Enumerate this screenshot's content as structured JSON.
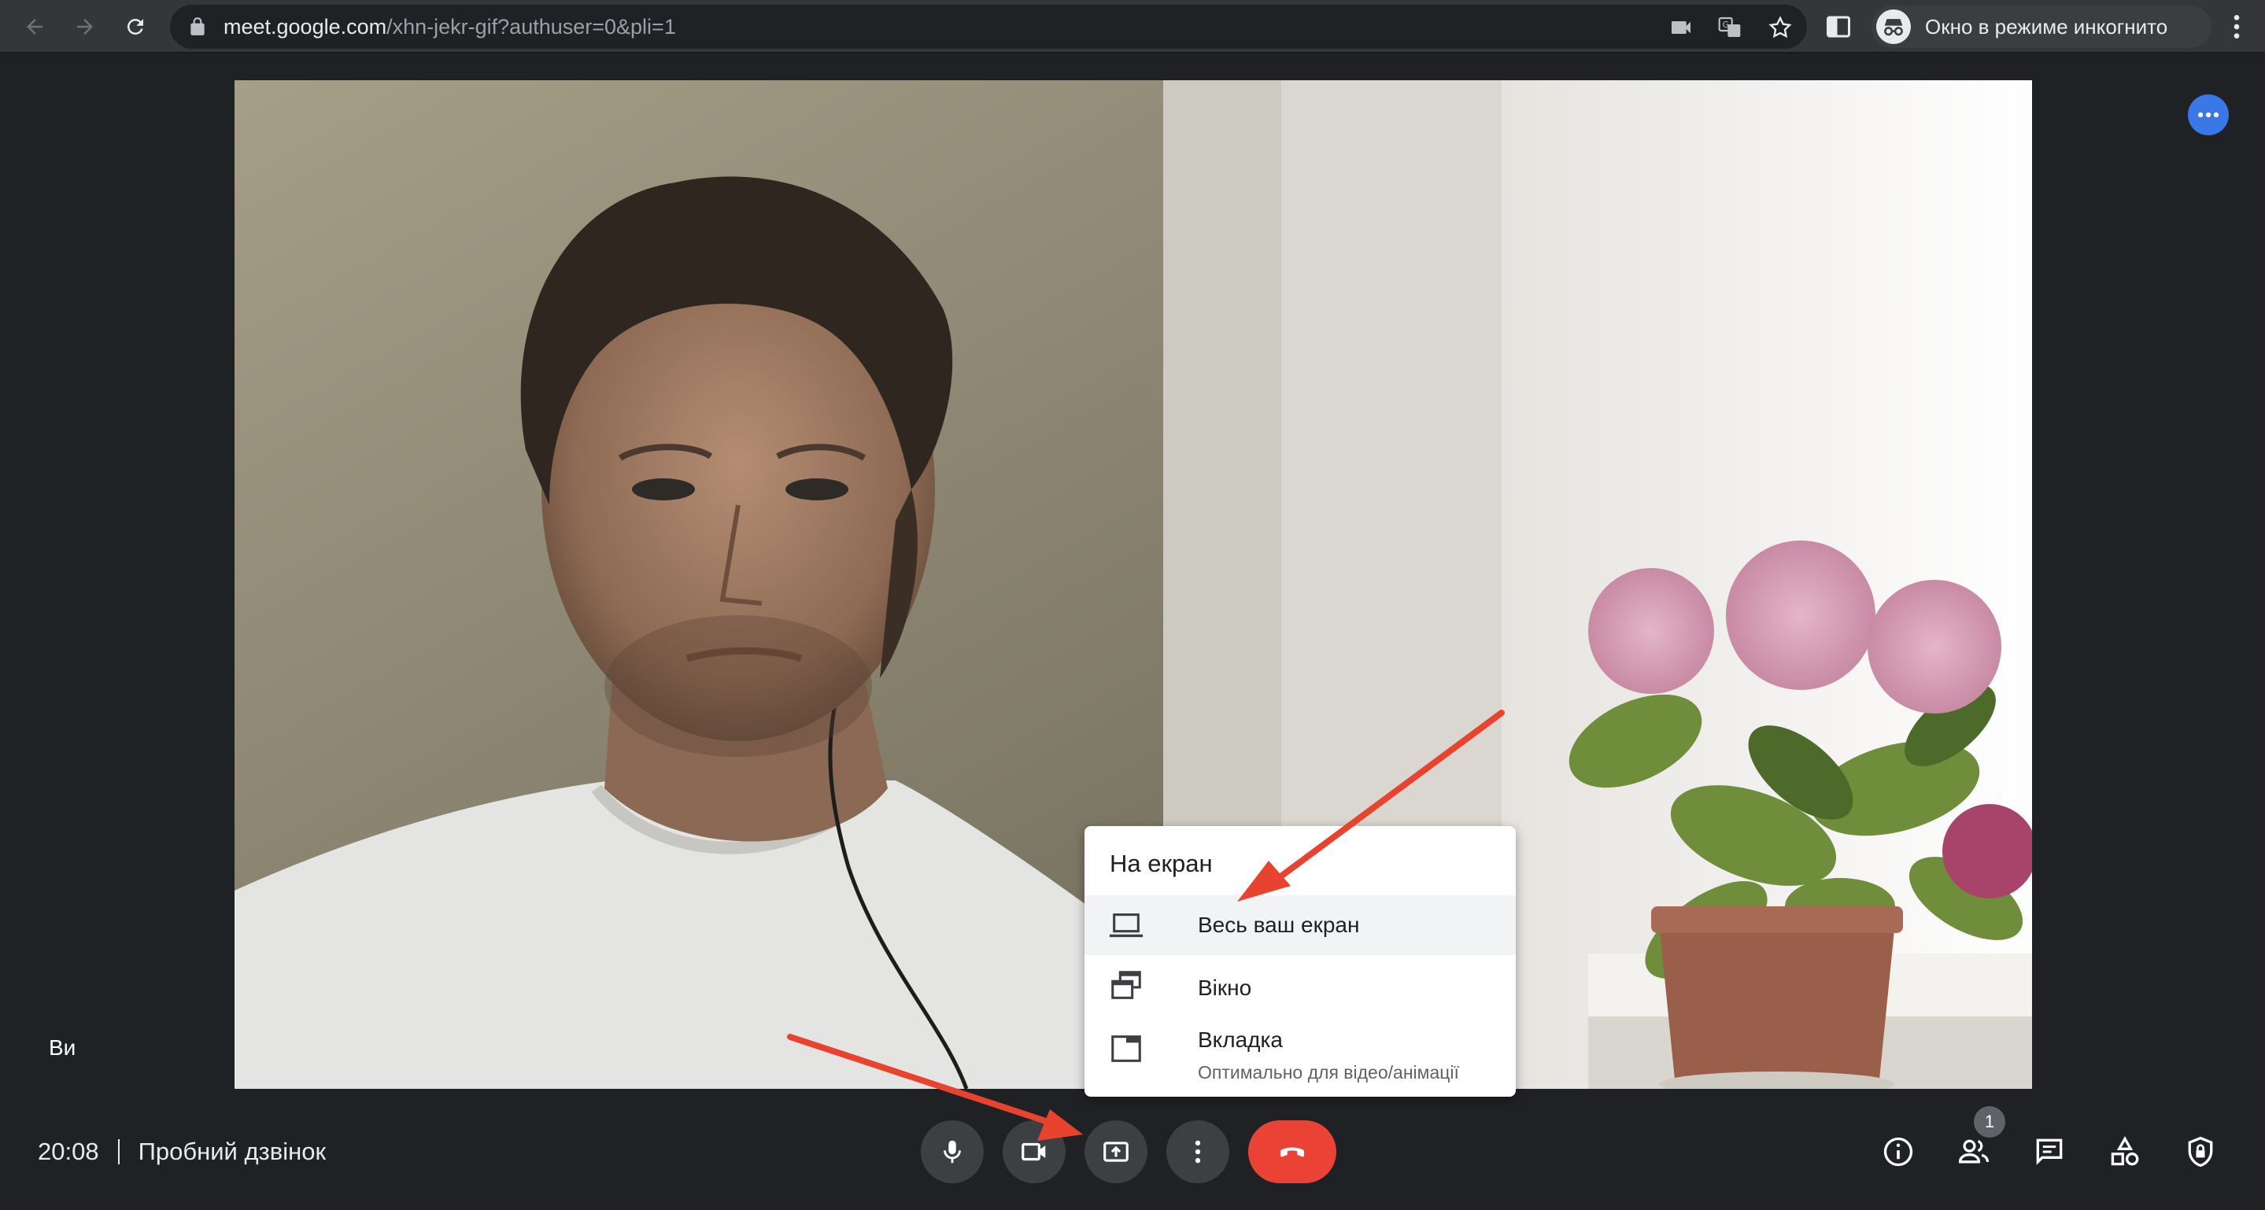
{
  "browser": {
    "url_host": "meet.google.com",
    "url_path": "/xhn-jekr-gif?authuser=0&pli=1",
    "incognito_label": "Окно в режиме инкогнито",
    "icons": [
      "back-arrow-icon",
      "forward-arrow-icon",
      "reload-icon",
      "lock-icon",
      "camera-icon",
      "translate-icon",
      "star-icon",
      "side-panel-icon",
      "incognito-icon",
      "kebab-menu-icon"
    ]
  },
  "stage": {
    "self_label": "Ви"
  },
  "share_menu": {
    "title": "На екран",
    "items": [
      {
        "label": "Весь ваш екран",
        "icon": "laptop-icon",
        "highlighted": true
      },
      {
        "label": "Вікно",
        "icon": "window-stack-icon"
      },
      {
        "label": "Вкладка",
        "sublabel": "Оптимально для відео/анімації",
        "icon": "tab-icon"
      }
    ]
  },
  "bottom_bar": {
    "time": "20:08",
    "meeting_name": "Пробний дзвінок",
    "controls": [
      "microphone-icon",
      "camera-icon",
      "present-screen-icon",
      "more-options-icon",
      "end-call-icon"
    ],
    "right_controls": [
      "info-icon",
      "people-icon",
      "chat-icon",
      "activities-icon",
      "host-controls-icon"
    ],
    "participants_count": "1"
  },
  "colors": {
    "background": "#202124",
    "chrome": "#35363a",
    "control": "#3c4043",
    "end_call": "#ea4335",
    "accent_blue": "#3b78e7",
    "annotation_arrow": "#e8432e"
  }
}
